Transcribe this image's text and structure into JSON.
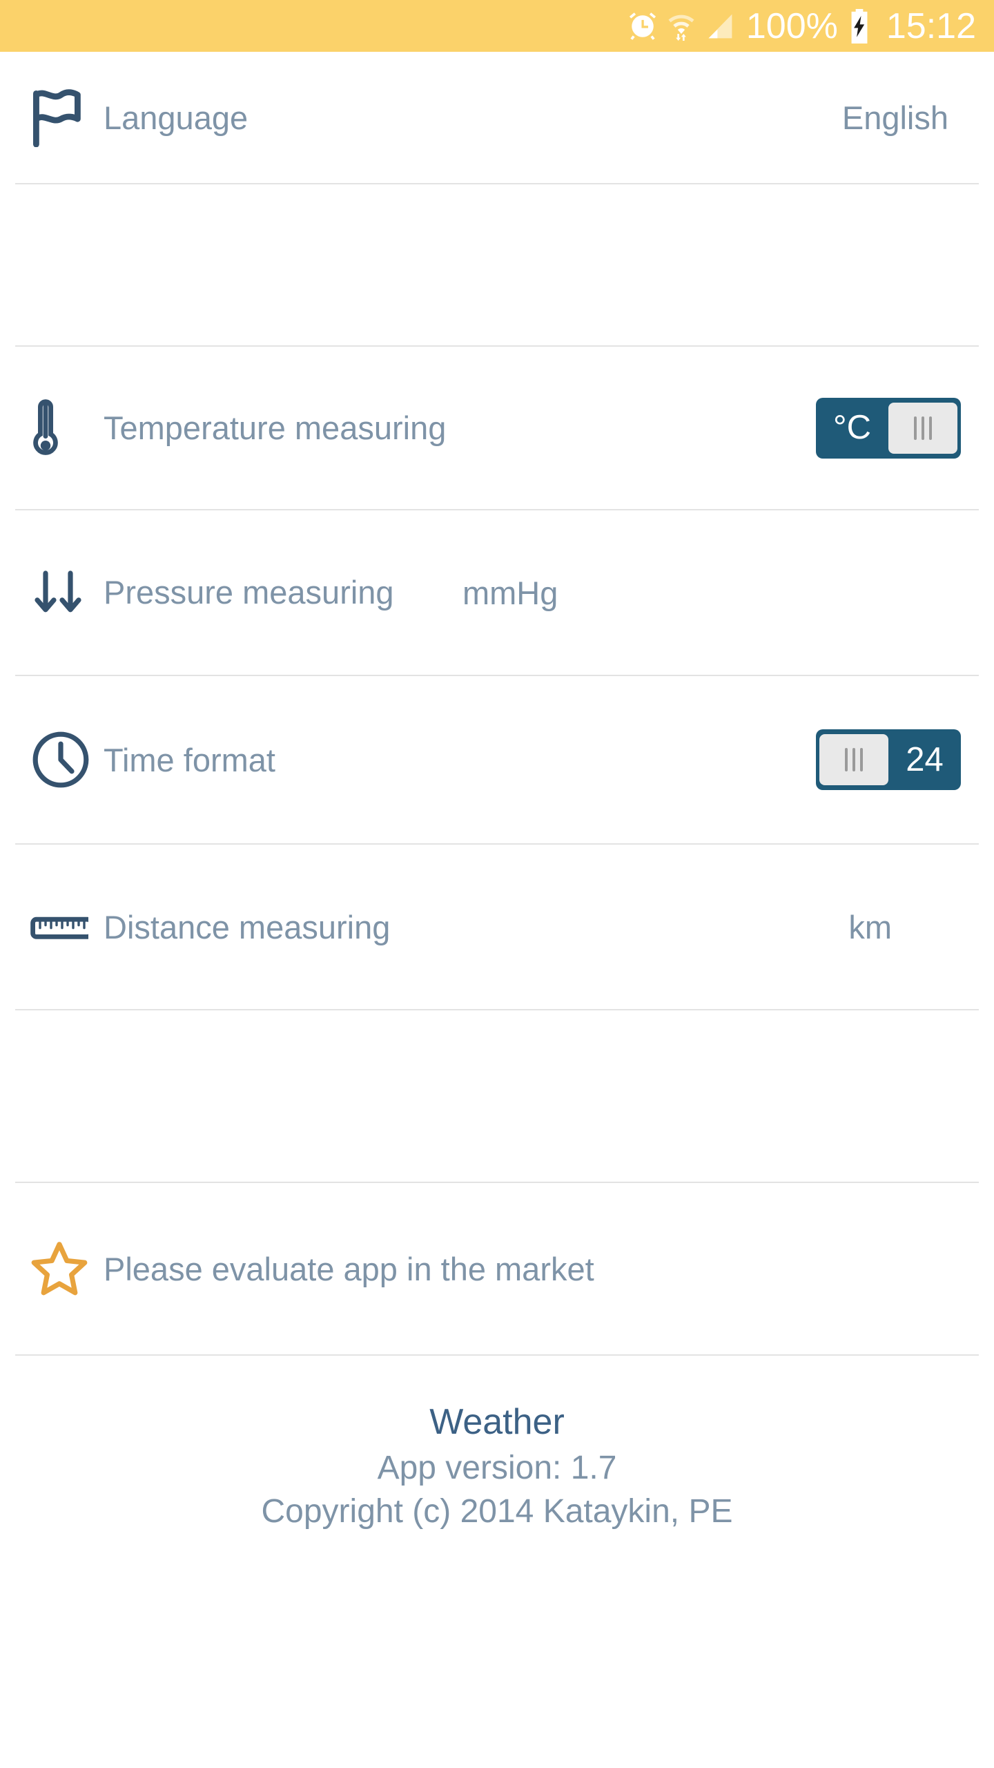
{
  "status_bar": {
    "background_color": "#fbd26a",
    "icons": [
      "alarm-clock-icon",
      "wifi-icon",
      "signal-bars-icon",
      "battery-charging-icon"
    ],
    "battery_percent": "100%",
    "clock": "15:12"
  },
  "settings": {
    "rows": [
      {
        "key": "language",
        "icon": "flag-icon",
        "label": "Language",
        "value": "English"
      },
      {
        "key": "temperature",
        "icon": "thermometer-icon",
        "label": "Temperature measuring",
        "toggle": {
          "text": "°C",
          "thumb_side": "right"
        }
      },
      {
        "key": "pressure",
        "icon": "double-down-arrow-icon",
        "label": "Pressure measuring",
        "value": "mmHg"
      },
      {
        "key": "time_format",
        "icon": "clock-icon",
        "label": "Time format",
        "toggle": {
          "text": "24",
          "thumb_side": "left"
        }
      },
      {
        "key": "distance",
        "icon": "ruler-icon",
        "label": "Distance measuring",
        "value": "km"
      },
      {
        "key": "rate_app",
        "icon": "star-icon",
        "label": "Please evaluate app in the market"
      }
    ]
  },
  "footer": {
    "app_name": "Weather",
    "version": "App version: 1.7",
    "copyright": "Copyright (c) 2014 Kataykin, PE"
  },
  "colors": {
    "status_bar": "#fbd26a",
    "icon_dark": "#35526e",
    "label_text": "#7e93a7",
    "toggle_active": "#1f5a78",
    "toggle_thumb": "#e9e9e9",
    "star_accent": "#e8a33d",
    "app_name": "#3c6185",
    "divider": "#e3e3e3"
  }
}
